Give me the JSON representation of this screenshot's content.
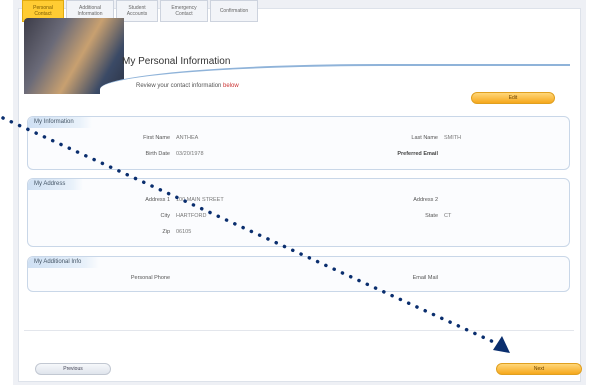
{
  "tabs": [
    {
      "label": "Personal Contact"
    },
    {
      "label": "Additional Information"
    },
    {
      "label": "Student Accounts"
    },
    {
      "label": "Emergency Contact"
    },
    {
      "label": "Confirmation"
    }
  ],
  "header": {
    "title": "My Personal Information",
    "subtitle_prefix": "Review your contact information",
    "subtitle_highlight": "below",
    "edit_label": "Edit"
  },
  "info": {
    "heading": "My Information",
    "first_name_label": "First Name",
    "first_name_value": "ANTHEA",
    "birth_date_label": "Birth Date",
    "birth_date_value": "03/20/1978",
    "last_name_label": "Last Name",
    "last_name_value": "SMITH",
    "preferred_email_label": "Preferred Email",
    "preferred_email_value": ""
  },
  "address": {
    "heading": "My Address",
    "address1_label": "Address 1",
    "address1_value": "100 MAIN STREET",
    "city_label": "City",
    "city_value": "HARTFORD",
    "zip_label": "Zip",
    "zip_value": "06105",
    "address2_label": "Address 2",
    "address2_value": "",
    "state_label": "State",
    "state_value": "CT"
  },
  "additional": {
    "heading": "My Additional Info",
    "personal_phone_label": "Personal Phone",
    "personal_phone_value": "",
    "email_mail_label": "Email Mail",
    "email_mail_value": ""
  },
  "footer": {
    "previous_label": "Previous",
    "next_label": "Next"
  },
  "colors": {
    "accent": "#ffcc33",
    "button_orange": "#f6a81c",
    "arrow": "#0a2e6e"
  }
}
